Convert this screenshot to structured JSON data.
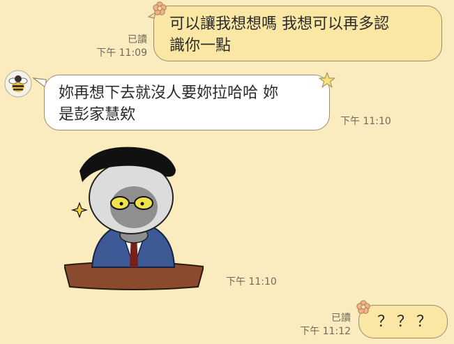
{
  "colors": {
    "background": "#faecbf",
    "outgoing_bubble": "#fbe7a4",
    "incoming_bubble": "#ffffff",
    "meta_text": "#6f6a5c"
  },
  "messages": [
    {
      "direction": "outgoing",
      "lines": [
        "可以讓我想想嗎 我想可以再多認",
        "識你一點"
      ],
      "read_label": "已讀",
      "time": "下午 11:09",
      "decoration": "flower-icon"
    },
    {
      "direction": "incoming",
      "avatar": "bee-avatar",
      "lines": [
        "妳再想下去就沒人要妳拉哈哈 妳",
        "是彭家慧欸"
      ],
      "time": "下午 11:10",
      "decoration": "star-icon"
    },
    {
      "direction": "incoming",
      "type": "sticker",
      "sticker": "businessman-sticker",
      "time": "下午 11:10"
    },
    {
      "direction": "outgoing",
      "lines": [
        "？？？"
      ],
      "read_label": "已讀",
      "time": "下午 11:12",
      "decoration": "flower-icon"
    }
  ]
}
